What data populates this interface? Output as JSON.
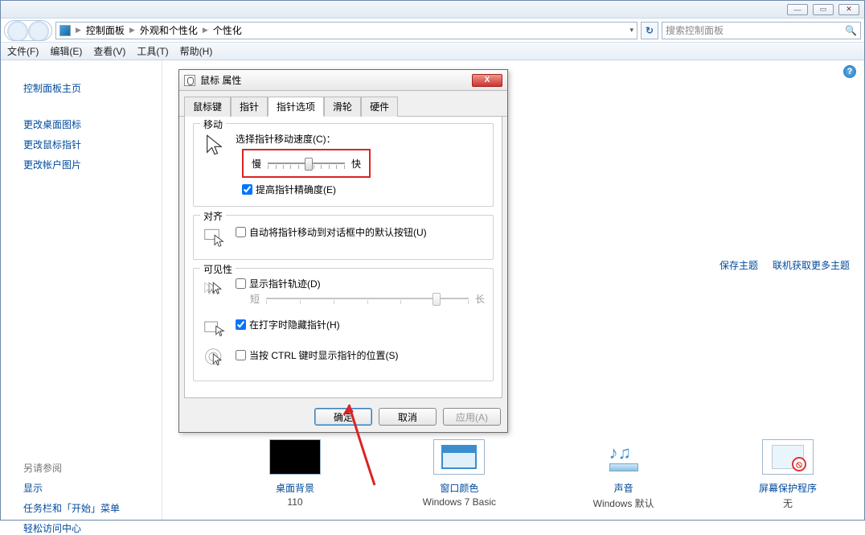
{
  "breadcrumb": {
    "root": "控制面板",
    "l2": "外观和个性化",
    "l3": "个性化"
  },
  "search": {
    "placeholder": "搜索控制面板"
  },
  "menu": {
    "file": "文件(F)",
    "edit": "编辑(E)",
    "view": "查看(V)",
    "tools": "工具(T)",
    "help": "帮助(H)"
  },
  "sidebar": {
    "home": "控制面板主页",
    "deskicons": "更改桌面图标",
    "pointer": "更改鼠标指针",
    "account": "更改帐户图片",
    "seealso": "另请参阅",
    "display": "显示",
    "taskbar": "任务栏和「开始」菜单",
    "ease": "轻松访问中心"
  },
  "rightlinks": {
    "save": "保存主题",
    "more": "联机获取更多主题"
  },
  "tiles": {
    "t1": {
      "cap1": "桌面背景",
      "cap2": "110"
    },
    "t2": {
      "cap1": "窗口颜色",
      "cap2": "Windows 7 Basic"
    },
    "t3": {
      "cap1": "声音",
      "cap2": "Windows 默认"
    },
    "t4": {
      "cap1": "屏幕保护程序",
      "cap2": "无"
    }
  },
  "dialog": {
    "title": "鼠标 属性",
    "tabs": {
      "t1": "鼠标键",
      "t2": "指针",
      "t3": "指针选项",
      "t4": "滑轮",
      "t5": "硬件"
    },
    "move": {
      "legend": "移动",
      "speed_label": "选择指针移动速度(C)：",
      "slow": "慢",
      "fast": "快",
      "enhance": "提高指针精确度(E)"
    },
    "snap": {
      "legend": "对齐",
      "auto": "自动将指针移动到对话框中的默认按钮(U)"
    },
    "vis": {
      "legend": "可见性",
      "trail": "显示指针轨迹(D)",
      "short": "短",
      "long": "长",
      "hide": "在打字时隐藏指针(H)",
      "ctrl": "当按 CTRL 键时显示指针的位置(S)"
    },
    "buttons": {
      "ok": "确定",
      "cancel": "取消",
      "apply": "应用(A)"
    }
  }
}
